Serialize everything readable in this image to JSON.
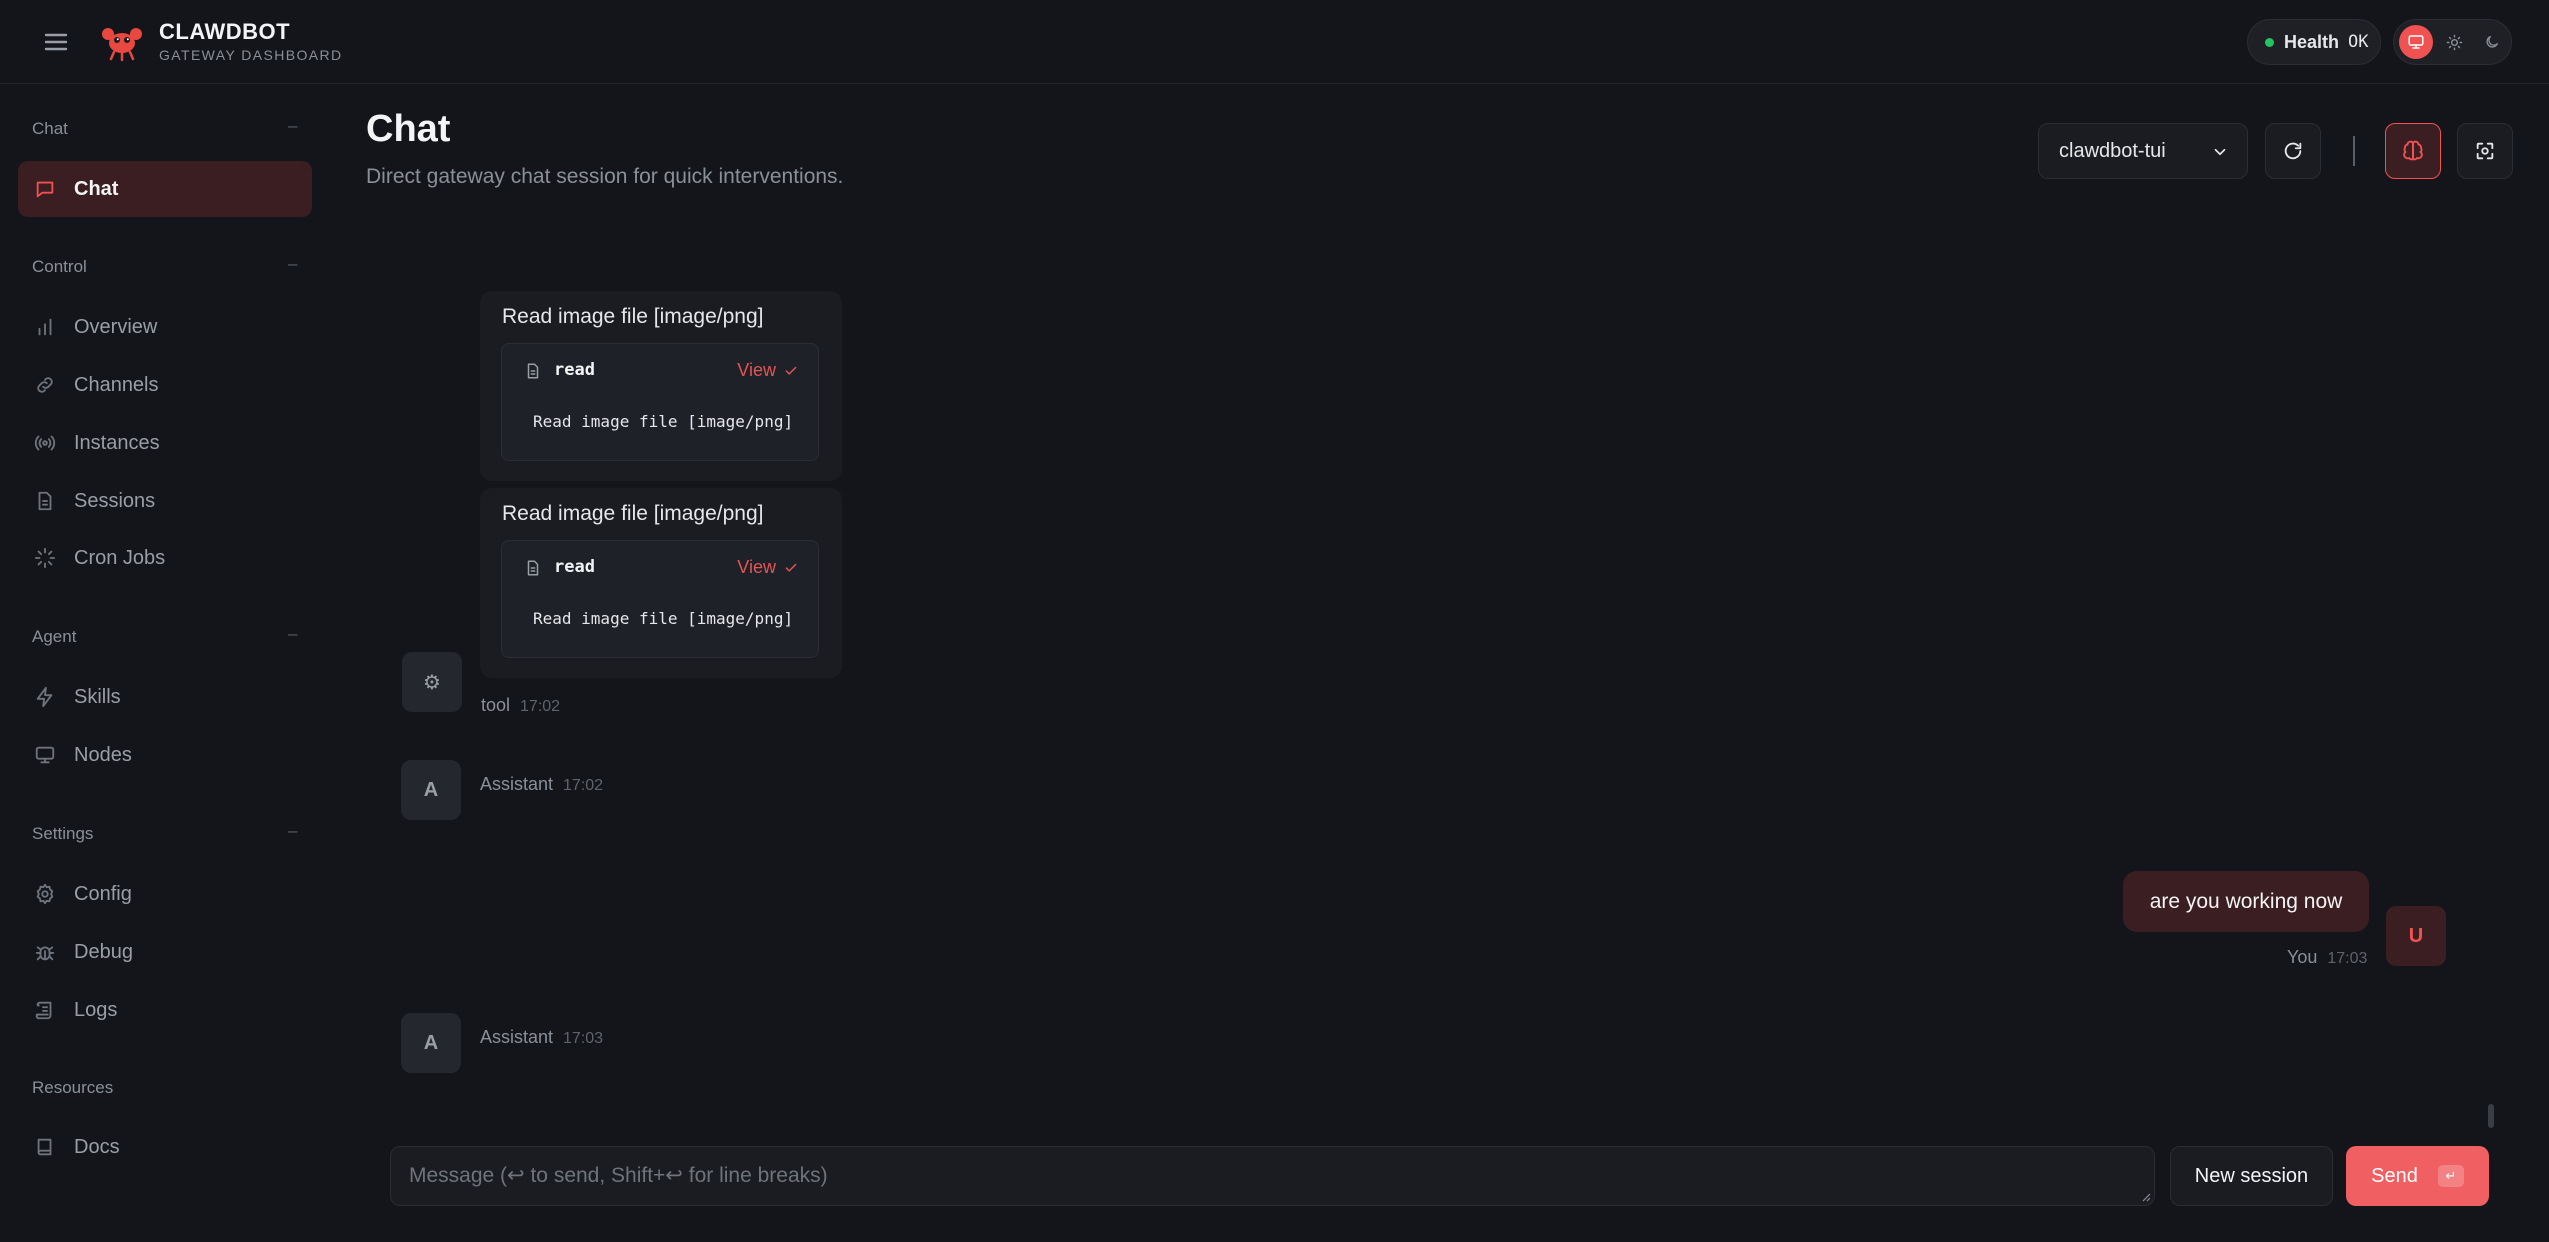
{
  "brand": {
    "name": "CLAWDBOT",
    "subtitle": "GATEWAY DASHBOARD"
  },
  "health": {
    "label": "Health",
    "value": "OK",
    "color": "#22c55e"
  },
  "theme": {
    "active": "system",
    "accent": "#f05252"
  },
  "sidebar": {
    "sections": [
      {
        "label": "Chat",
        "items": [
          {
            "label": "Chat",
            "icon": "message-icon",
            "active": true
          }
        ]
      },
      {
        "label": "Control",
        "items": [
          {
            "label": "Overview",
            "icon": "bar-chart-icon"
          },
          {
            "label": "Channels",
            "icon": "link-icon"
          },
          {
            "label": "Instances",
            "icon": "radio-icon"
          },
          {
            "label": "Sessions",
            "icon": "file-icon"
          },
          {
            "label": "Cron Jobs",
            "icon": "loader-icon"
          }
        ]
      },
      {
        "label": "Agent",
        "items": [
          {
            "label": "Skills",
            "icon": "zap-icon"
          },
          {
            "label": "Nodes",
            "icon": "monitor-icon"
          }
        ]
      },
      {
        "label": "Settings",
        "items": [
          {
            "label": "Config",
            "icon": "gear-icon"
          },
          {
            "label": "Debug",
            "icon": "bug-icon"
          },
          {
            "label": "Logs",
            "icon": "scroll-icon"
          }
        ]
      },
      {
        "label": "Resources",
        "items": [
          {
            "label": "Docs",
            "icon": "book-icon"
          }
        ]
      }
    ]
  },
  "header": {
    "title": "Chat",
    "subtitle": "Direct gateway chat session for quick interventions.",
    "session": "clawdbot-tui"
  },
  "messages": {
    "tool_cards": [
      {
        "title": "Read image file [image/png]",
        "tool": "read",
        "view_label": "View",
        "output": "Read image file [image/png]"
      },
      {
        "title": "Read image file [image/png]",
        "tool": "read",
        "view_label": "View",
        "output": "Read image file [image/png]"
      }
    ],
    "tool_meta": {
      "avatar": "⚙",
      "sender": "tool",
      "time": "17:02"
    },
    "assistant1": {
      "avatar": "A",
      "sender": "Assistant",
      "time": "17:02"
    },
    "user": {
      "avatar": "U",
      "text": "are you working now",
      "sender": "You",
      "time": "17:03"
    },
    "assistant2": {
      "avatar": "A",
      "sender": "Assistant",
      "time": "17:03"
    }
  },
  "composer": {
    "placeholder": "Message (↩ to send, Shift+↩ for line breaks)",
    "new_session_label": "New session",
    "send_label": "Send",
    "send_kbd": "↵"
  }
}
